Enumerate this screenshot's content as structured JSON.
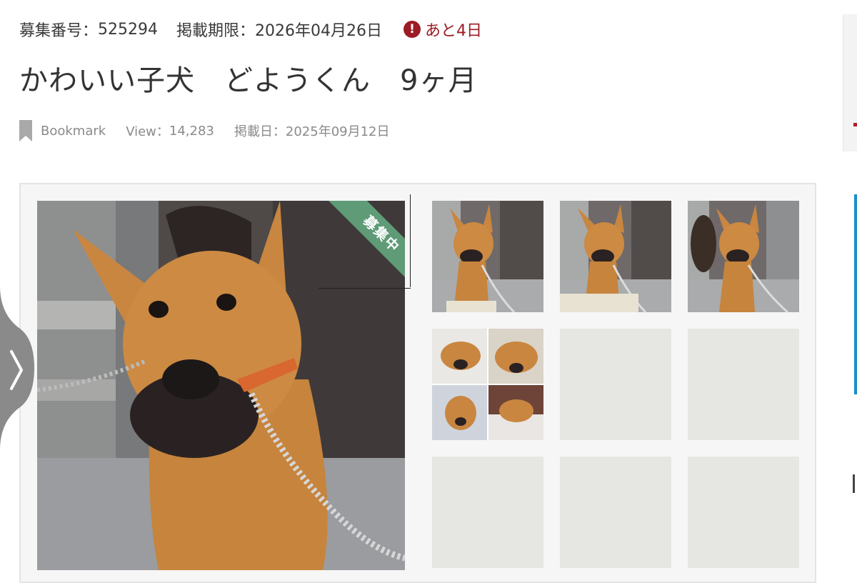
{
  "listing": {
    "recruit_label": "募集番号：",
    "recruit_number": "525294",
    "deadline_label": "掲載期限：",
    "deadline_date": "2026年04月26日",
    "remaining_icon": "exclamation-circle-icon",
    "remaining_text": "あと4日",
    "title": "かわいい子犬　どようくん　9ヶ月",
    "bookmark_label": "Bookmark",
    "bookmark_icon": "bookmark-icon",
    "view_label": "View：",
    "view_count": "14,283",
    "posted_label": "掲載日：",
    "posted_date": "2025年09月12日"
  },
  "gallery": {
    "status_ribbon": "募集中",
    "thumbnails": [
      {
        "type": "photo"
      },
      {
        "type": "photo"
      },
      {
        "type": "photo"
      },
      {
        "type": "collage"
      },
      {
        "type": "empty"
      },
      {
        "type": "empty"
      },
      {
        "type": "empty"
      },
      {
        "type": "empty"
      },
      {
        "type": "empty"
      }
    ],
    "carousel_prev_icon": "chevron-right-icon"
  },
  "colors": {
    "alert": "#9b1c24",
    "ribbon": "#5e9b76",
    "placeholder": "#e6e7e2"
  }
}
